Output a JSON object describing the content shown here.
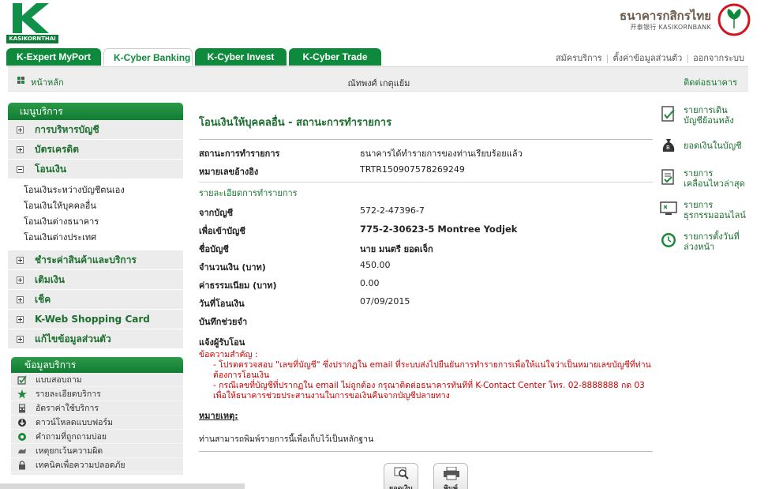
{
  "header": {
    "logo_text": "KASIKORNTHAI",
    "bank_name_th": "ธนาคารกสิกรไทย",
    "bank_name_en": "开泰银行 KASIKORNBANK"
  },
  "tabs": [
    {
      "label": "K-Expert MyPort"
    },
    {
      "label": "K-Cyber Banking"
    },
    {
      "label": "K-Cyber Invest"
    },
    {
      "label": "K-Cyber Trade"
    }
  ],
  "top_links": [
    "สมัครบริการ",
    "ตั้งค่าข้อมูลส่วนตัว",
    "ออกจากระบบ"
  ],
  "bar": {
    "home": "หน้าหลัก",
    "user": "ณัทพงศ์ เกตุแย้ม",
    "contact": "ติดต่อธนาคาร"
  },
  "sidebar": {
    "title": "เมนูบริการ",
    "groups_top": [
      "การบริหารบัญชี",
      "บัตรเครดิต"
    ],
    "open_group": "โอนเงิน",
    "open_items": [
      "โอนเงินระหว่างบัญชีตนเอง",
      "โอนเงินให้บุคคลอื่น",
      "โอนเงินต่างธนาคาร",
      "โอนเงินต่างประเทศ"
    ],
    "groups_bottom": [
      "ชำระค่าสินค้าและบริการ",
      "เติมเงิน",
      "เช็ค",
      "K-Web Shopping Card",
      "แก้ไขข้อมูลส่วนตัว"
    ]
  },
  "info": {
    "title": "ข้อมูลบริการ",
    "items": [
      "แบบสอบถาม",
      "รายละเอียดบริการ",
      "อัตราค่าใช้บริการ",
      "ดาวน์โหลดแบบฟอร์ม",
      "คำถามที่ถูกถามบ่อย",
      "เหตุยกเว้นความผิด",
      "เทคนิคเพื่อความปลอดภัย"
    ]
  },
  "main": {
    "title": "โอนเงินให้บุคคลอื่น - สถานะการทำรายการ",
    "status_label": "สถานะการทำรายการ",
    "status_value": "ธนาคารได้ทำรายการของท่านเรียบร้อยแล้ว",
    "ref_label": "หมายเลขอ้างอิง",
    "ref_value": "TRTR150907578269249",
    "details_title": "รายละเอียดการทำรายการ",
    "from_label": "จากบัญชี",
    "from_value": "572-2-47396-7",
    "to_label": "เพื่อเข้าบัญชี",
    "to_value": "775-2-30623-5 Montree Yodjek",
    "name_label": "ชื่อบัญชี",
    "name_value": "นาย มนตรี ยอดเจ็ก",
    "amount_label": "จำนวนเงิน (บาท)",
    "amount_value": "450.00",
    "fee_label": "ค่าธรรมเนียม (บาท)",
    "fee_value": "0.00",
    "date_label": "วันที่โอนเงิน",
    "date_value": "07/09/2015",
    "memo_label": "บันทึกช่วยจำ",
    "notify_label": "แจ้งผู้รับโอน",
    "important_head": "ข้อความสำคัญ :",
    "important_1": "- โปรดตรวจสอบ \"เลขที่บัญชี\" ซึ่งปรากฏใน email ที่ระบบส่งไปยืนยันการทำรายการเพื่อให้แน่ใจว่าเป็นหมายเลขบัญชีที่ท่านต้องการโอนเงิน",
    "important_2": "- กรณีเลขที่บัญชีที่ปรากฏใน email ไม่ถูกต้อง กรุณาติดต่อธนาคารทันทีที่ K-Contact Center โทร. 02-8888888 กด 03 เพื่อให้ธนาคารช่วยประสานงานในการขอเงินคืนจากบัญชีปลายทาง",
    "remark_head": "หมายเหตุ:",
    "remark_body": "ท่านสามารถพิมพ์รายการนี้เพื่อเก็บไว้เป็นหลักฐาน",
    "btn_balance": "ยอดเงิน",
    "btn_print": "พิมพ์"
  },
  "right_links": [
    {
      "line1": "รายการเดิน",
      "line2": "บัญชีย้อนหลัง"
    },
    {
      "line1": "ยอดเงินในบัญชี",
      "line2": ""
    },
    {
      "line1": "รายการ",
      "line2": "เคลื่อนไหวล่าสุด"
    },
    {
      "line1": "รายการ",
      "line2": "ธุรกรรมออนไลน์"
    },
    {
      "line1": "รายการตั้งวันที่",
      "line2": "ล่วงหน้า"
    }
  ],
  "colors": {
    "brand_green": "#0f8a3d",
    "text_green": "#1b6e2e",
    "alert_red": "#cc0000"
  }
}
